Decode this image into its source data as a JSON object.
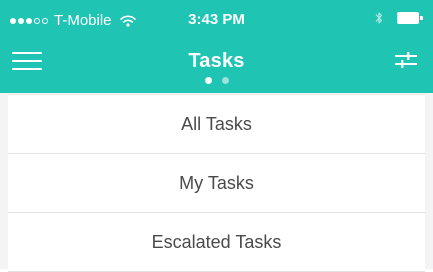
{
  "status_bar": {
    "carrier": "T-Mobile",
    "time": "3:43 PM",
    "signal_filled": 3,
    "signal_total": 5
  },
  "nav": {
    "title": "Tasks",
    "page_count": 2,
    "active_page": 1,
    "menu_icon": "hamburger-menu-icon",
    "filter_icon": "sliders-filter-icon"
  },
  "tasks": [
    {
      "label": "All Tasks"
    },
    {
      "label": "My Tasks"
    },
    {
      "label": "Escalated Tasks"
    }
  ],
  "colors": {
    "header_bg": "#1fc4b3",
    "list_text": "#4a4a4a"
  }
}
